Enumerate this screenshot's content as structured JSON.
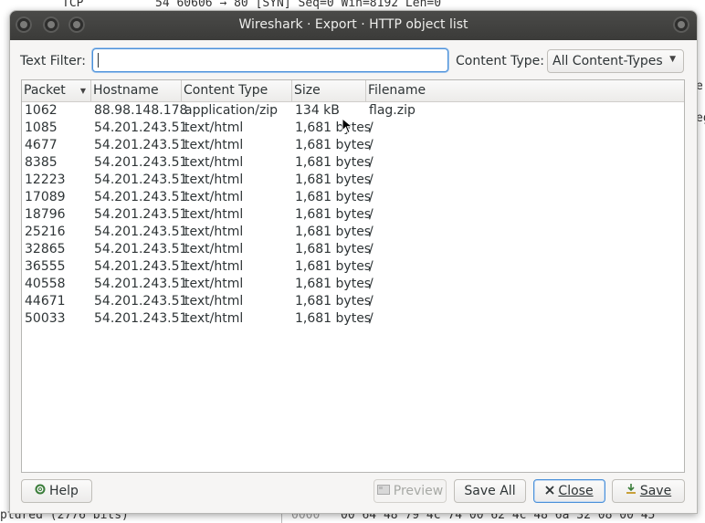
{
  "background": {
    "top_text": {
      "protocol": "TCP",
      "info": "54 60606 → 80 [SYN] Seq=0 Win=8192 Len=0"
    },
    "right_fragments": [
      "er",
      "eg"
    ],
    "status_text": "ptured (2776 bits)",
    "hex_offset": "0000",
    "hex_bytes": "00 64 48 79 4c 74 00 62  4c 48 6a 32 08 00 45"
  },
  "window": {
    "title": "Wireshark · Export · HTTP object list"
  },
  "filter": {
    "label": "Text Filter:",
    "value": "",
    "content_type_label": "Content Type:",
    "content_type_value": "All Content-Types"
  },
  "table": {
    "columns": [
      "Packet",
      "Hostname",
      "Content Type",
      "Size",
      "Filename"
    ],
    "rows": [
      {
        "packet": "1062",
        "host": "88.98.148.178",
        "type": "application/zip",
        "size": "134 kB",
        "file": "flag.zip"
      },
      {
        "packet": "1085",
        "host": "54.201.243.51",
        "type": "text/html",
        "size": "1,681 bytes",
        "file": "/"
      },
      {
        "packet": "4677",
        "host": "54.201.243.51",
        "type": "text/html",
        "size": "1,681 bytes",
        "file": "/"
      },
      {
        "packet": "8385",
        "host": "54.201.243.51",
        "type": "text/html",
        "size": "1,681 bytes",
        "file": "/"
      },
      {
        "packet": "12223",
        "host": "54.201.243.51",
        "type": "text/html",
        "size": "1,681 bytes",
        "file": "/"
      },
      {
        "packet": "17089",
        "host": "54.201.243.51",
        "type": "text/html",
        "size": "1,681 bytes",
        "file": "/"
      },
      {
        "packet": "18796",
        "host": "54.201.243.51",
        "type": "text/html",
        "size": "1,681 bytes",
        "file": "/"
      },
      {
        "packet": "25216",
        "host": "54.201.243.51",
        "type": "text/html",
        "size": "1,681 bytes",
        "file": "/"
      },
      {
        "packet": "32865",
        "host": "54.201.243.51",
        "type": "text/html",
        "size": "1,681 bytes",
        "file": "/"
      },
      {
        "packet": "36555",
        "host": "54.201.243.51",
        "type": "text/html",
        "size": "1,681 bytes",
        "file": "/"
      },
      {
        "packet": "40558",
        "host": "54.201.243.51",
        "type": "text/html",
        "size": "1,681 bytes",
        "file": "/"
      },
      {
        "packet": "44671",
        "host": "54.201.243.51",
        "type": "text/html",
        "size": "1,681 bytes",
        "file": "/"
      },
      {
        "packet": "50033",
        "host": "54.201.243.51",
        "type": "text/html",
        "size": "1,681 bytes",
        "file": "/"
      }
    ]
  },
  "buttons": {
    "help": "Help",
    "preview": "Preview",
    "save_all": "Save All",
    "close": "Close",
    "save": "Save"
  },
  "icons": {
    "help": "help-icon",
    "preview": "preview-icon",
    "close": "close-icon",
    "save": "save-icon"
  },
  "colors": {
    "titlebar": "#3b3b39",
    "focus": "#4a90d9"
  }
}
